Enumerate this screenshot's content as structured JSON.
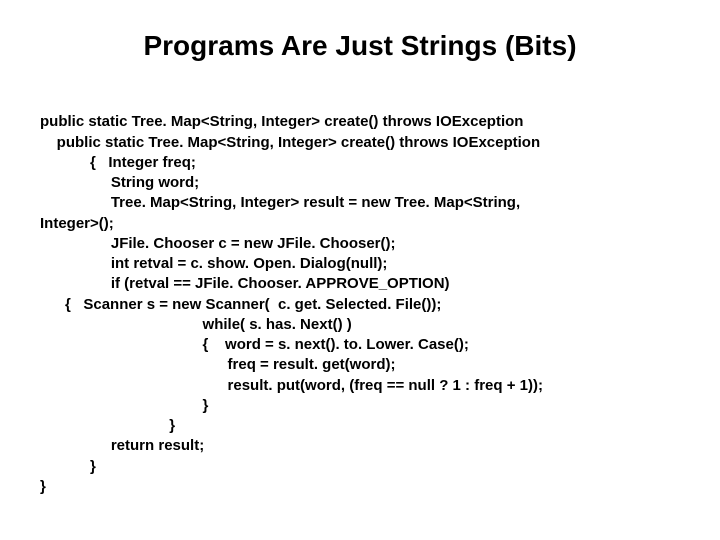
{
  "title": "Programs Are Just Strings (Bits)",
  "code": {
    "l1": "public static Tree. Map<String, Integer> create() throws IOException",
    "l2": "    public static Tree. Map<String, Integer> create() throws IOException",
    "l3": "            {   Integer freq;",
    "l4": "                 String word;",
    "l5": "                 Tree. Map<String, Integer> result = new Tree. Map<String,",
    "l6": "Integer>();",
    "l7": "                 JFile. Chooser c = new JFile. Chooser();",
    "l8": "                 int retval = c. show. Open. Dialog(null);",
    "l9": "                 if (retval == JFile. Chooser. APPROVE_OPTION)",
    "l10": "      {   Scanner s = new Scanner(  c. get. Selected. File());",
    "l11": "                                       while( s. has. Next() )",
    "l12": "                                       {    word = s. next(). to. Lower. Case();",
    "l13": "                                             freq = result. get(word);",
    "l14": "                                             result. put(word, (freq == null ? 1 : freq + 1));",
    "l15": "                                       }",
    "l16": "                               }",
    "l17": "                 return result;",
    "l18": "            }",
    "l19": "}"
  }
}
